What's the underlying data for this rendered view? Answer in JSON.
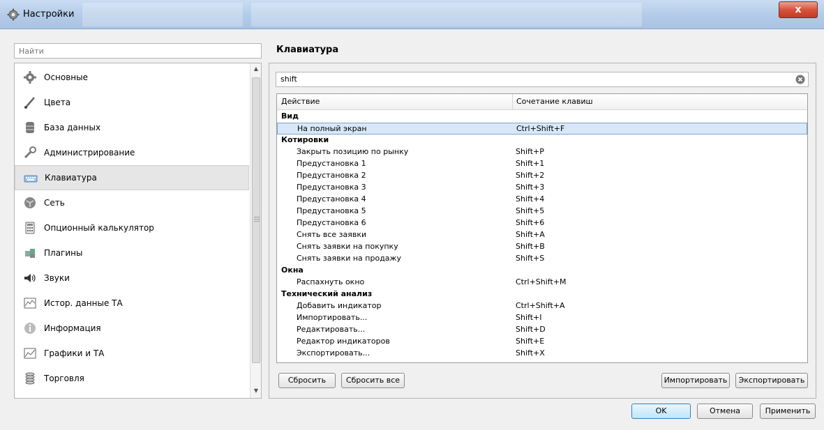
{
  "window": {
    "title": "Настройки",
    "close_label": "x"
  },
  "search": {
    "placeholder": "Найти",
    "value": ""
  },
  "sidebar": {
    "items": [
      {
        "label": "Основные",
        "icon": "gear-icon"
      },
      {
        "label": "Цвета",
        "icon": "brush-icon"
      },
      {
        "label": "База данных",
        "icon": "database-icon"
      },
      {
        "label": "Администрирование",
        "icon": "wrench-icon"
      },
      {
        "label": "Клавиатура",
        "icon": "keyboard-icon",
        "selected": true
      },
      {
        "label": "Сеть",
        "icon": "network-icon"
      },
      {
        "label": "Опционный калькулятор",
        "icon": "calculator-icon"
      },
      {
        "label": "Плагины",
        "icon": "puzzle-icon"
      },
      {
        "label": "Звуки",
        "icon": "speaker-icon"
      },
      {
        "label": "Истор. данные ТА",
        "icon": "history-chart-icon"
      },
      {
        "label": "Информация",
        "icon": "info-icon"
      },
      {
        "label": "Графики и ТА",
        "icon": "line-chart-icon"
      },
      {
        "label": "Торговля",
        "icon": "coins-icon"
      }
    ]
  },
  "page": {
    "title": "Клавиатура"
  },
  "filter": {
    "value": "shift"
  },
  "table": {
    "headers": {
      "action": "Действие",
      "shortcut": "Сочетание клавиш"
    },
    "rows": [
      {
        "type": "group",
        "action": "Вид",
        "keys": ""
      },
      {
        "type": "item",
        "action": "На полный экран",
        "keys": "Ctrl+Shift+F",
        "selected": true
      },
      {
        "type": "group",
        "action": "Котировки",
        "keys": ""
      },
      {
        "type": "item",
        "action": "Закрыть позицию по рынку",
        "keys": "Shift+P"
      },
      {
        "type": "item",
        "action": "Предустановка 1",
        "keys": "Shift+1"
      },
      {
        "type": "item",
        "action": "Предустановка 2",
        "keys": "Shift+2"
      },
      {
        "type": "item",
        "action": "Предустановка 3",
        "keys": "Shift+3"
      },
      {
        "type": "item",
        "action": "Предустановка 4",
        "keys": "Shift+4"
      },
      {
        "type": "item",
        "action": "Предустановка 5",
        "keys": "Shift+5"
      },
      {
        "type": "item",
        "action": "Предустановка 6",
        "keys": "Shift+6"
      },
      {
        "type": "item",
        "action": "Снять все заявки",
        "keys": "Shift+A"
      },
      {
        "type": "item",
        "action": "Снять заявки на покупку",
        "keys": "Shift+B"
      },
      {
        "type": "item",
        "action": "Снять заявки на продажу",
        "keys": "Shift+S"
      },
      {
        "type": "group",
        "action": "Окна",
        "keys": ""
      },
      {
        "type": "item",
        "action": "Распахнуть окно",
        "keys": "Ctrl+Shift+M"
      },
      {
        "type": "group",
        "action": "Технический анализ",
        "keys": ""
      },
      {
        "type": "item",
        "action": "Добавить индикатор",
        "keys": "Ctrl+Shift+A"
      },
      {
        "type": "item",
        "action": "Импортировать...",
        "keys": "Shift+I"
      },
      {
        "type": "item",
        "action": "Редактировать...",
        "keys": "Shift+D"
      },
      {
        "type": "item",
        "action": "Редактор индикаторов",
        "keys": "Shift+E"
      },
      {
        "type": "item",
        "action": "Экспортировать...",
        "keys": "Shift+X"
      }
    ]
  },
  "buttons": {
    "reset": "Сбросить",
    "reset_all": "Сбросить все",
    "import": "Импортировать",
    "export": "Экспортировать",
    "ok": "OK",
    "cancel": "Отмена",
    "apply": "Применить"
  },
  "colors": {
    "selection_bg": "#d8e8f8",
    "selection_border": "#7da2ce",
    "close_button": "#c94a34"
  }
}
